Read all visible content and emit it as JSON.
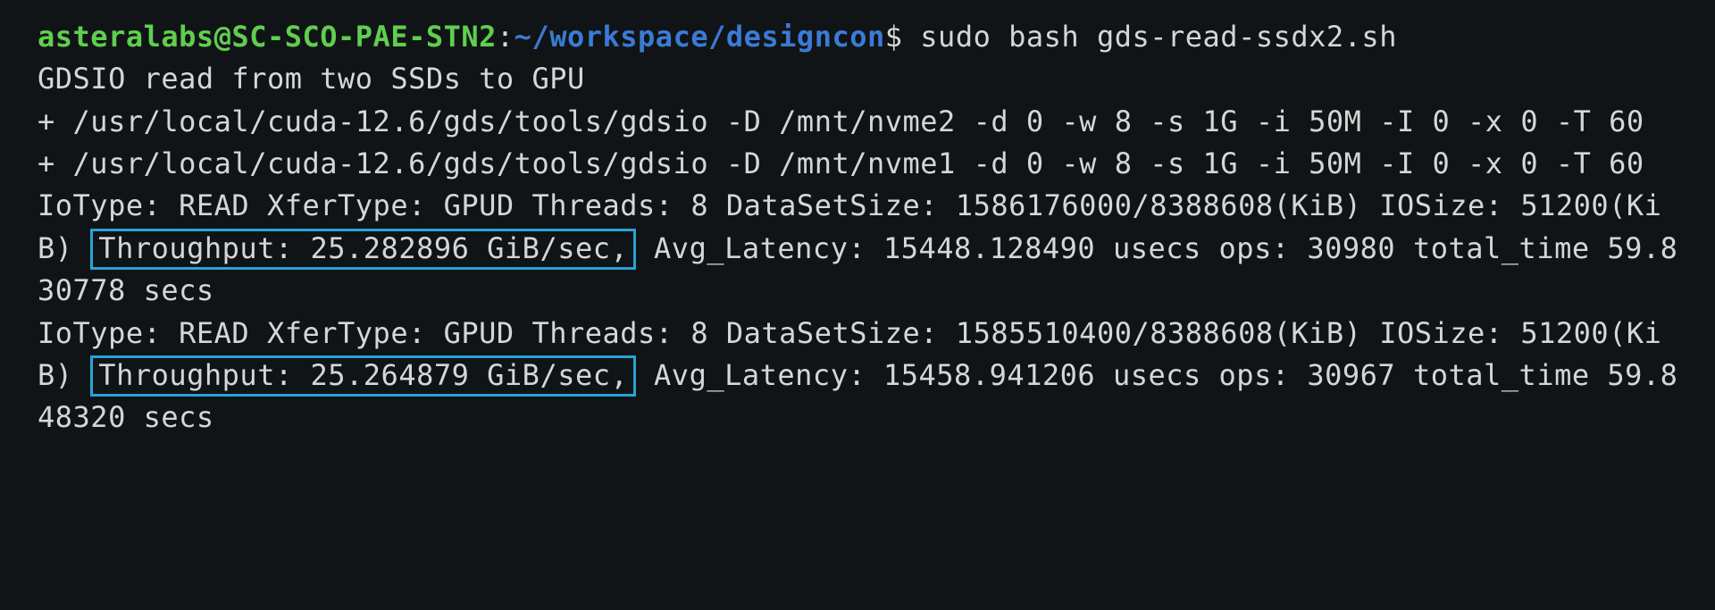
{
  "prompt": {
    "user": "asteralabs",
    "at": "@",
    "host": "SC-SCO-PAE-STN2",
    "colon": ":",
    "path": "~/workspace/designcon",
    "dollar": "$",
    "command": " sudo bash gds-read-ssdx2.sh"
  },
  "lines": {
    "l01": "GDSIO read from two SSDs to GPU",
    "l02": "+ /usr/local/cuda-12.6/gds/tools/gdsio -D /mnt/nvme2 -d 0 -w 8 -s 1G -i 50M -I 0 -x 0 -T 60",
    "l03": "+ /usr/local/cuda-12.6/gds/tools/gdsio -D /mnt/nvme1 -d 0 -w 8 -s 1G -i 50M -I 0 -x 0 -T 60",
    "r1a": "IoType: READ XferType: GPUD Threads: 8 DataSetSize: 1586176000/8388608(KiB) IOSize: 51200(KiB) ",
    "r1h": "Throughput: 25.282896 GiB/sec,",
    "r1b": " Avg_Latency: 15448.128490 usecs ops: 30980 total_time 59.830778 secs",
    "r2a": "IoType: READ XferType: GPUD Threads: 8 DataSetSize: 1585510400/8388608(KiB) IOSize: 51200(KiB) ",
    "r2h": "Throughput: 25.264879 GiB/sec,",
    "r2b": " Avg_Latency: 15458.941206 usecs ops: 30967 total_time 59.848320 secs"
  }
}
